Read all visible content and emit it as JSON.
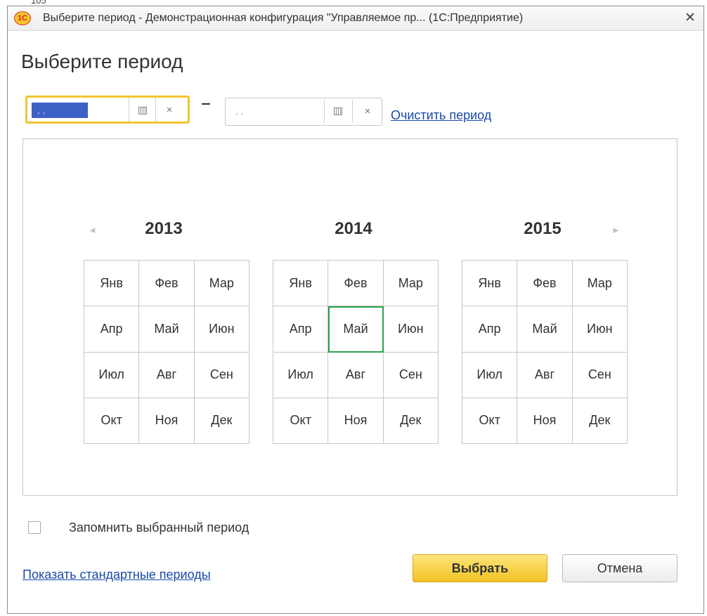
{
  "page_number": "105",
  "window": {
    "title": "Выберите период - Демонстрационная конфигурация \"Управляемое пр... (1С:Предприятие)",
    "logo_text": "1С",
    "close_glyph": "✕"
  },
  "heading": "Выберите период",
  "period": {
    "start_value": ". .",
    "end_value": ". .",
    "separator": "–",
    "calendar_icon": "calendar-icon",
    "clear_glyph": "×",
    "clear_link": "Очистить период"
  },
  "calendar": {
    "prev_arrow": "◄",
    "next_arrow": "►",
    "years": [
      {
        "label": "2013",
        "months": [
          "Янв",
          "Фев",
          "Мар",
          "Апр",
          "Май",
          "Июн",
          "Июл",
          "Авг",
          "Сен",
          "Окт",
          "Ноя",
          "Дек"
        ]
      },
      {
        "label": "2014",
        "months": [
          "Янв",
          "Фев",
          "Мар",
          "Апр",
          "Май",
          "Июн",
          "Июл",
          "Авг",
          "Сен",
          "Окт",
          "Ноя",
          "Дек"
        ],
        "current_month": "Май"
      },
      {
        "label": "2015",
        "months": [
          "Янв",
          "Фев",
          "Мар",
          "Апр",
          "Май",
          "Июн",
          "Июл",
          "Авг",
          "Сен",
          "Окт",
          "Ноя",
          "Дек"
        ]
      }
    ]
  },
  "remember": {
    "label": "Запомнить выбранный период",
    "checked": false
  },
  "standard_periods_link": "Показать стандартные периоды",
  "buttons": {
    "select": "Выбрать",
    "cancel": "Отмена"
  },
  "colors": {
    "focus_border": "#f4c433",
    "selection": "#3e61c7",
    "current_month": "#2aa14b",
    "link": "#1a4aa8",
    "primary_button": "#f1c223"
  }
}
